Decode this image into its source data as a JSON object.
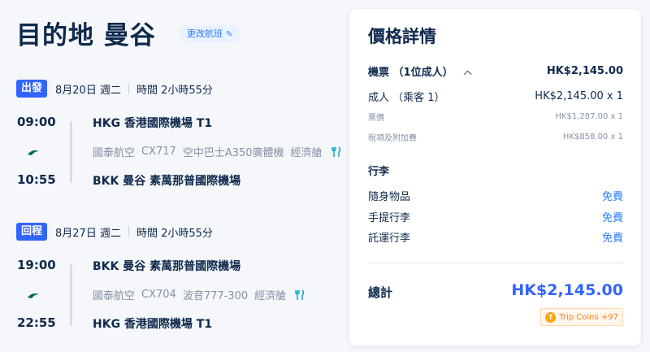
{
  "header": {
    "title": "目的地 曼谷",
    "change_label": "更改航班"
  },
  "outbound": {
    "badge": "出發",
    "date": "8月20日 週二",
    "duration": "時間 2小時55分",
    "depart_time": "09:00",
    "arrive_time": "10:55",
    "depart_place": "HKG 香港國際機場 T1",
    "arrive_place": "BKK 曼谷 素萬那普國際機場",
    "airline": "國泰航空",
    "flight_no": "CX717",
    "aircraft": "空中巴士A350廣體機",
    "cabin": "經濟艙"
  },
  "return": {
    "badge": "回程",
    "date": "8月27日 週二",
    "duration": "時間 2小時55分",
    "depart_time": "19:00",
    "arrive_time": "22:55",
    "depart_place": "BKK 曼谷 素萬那普國際機場",
    "arrive_place": "HKG 香港國際機場 T1",
    "airline": "國泰航空",
    "flight_no": "CX704",
    "aircraft": "波音777-300",
    "cabin": "經濟艙"
  },
  "price": {
    "title": "價格詳情",
    "ticket_label": "機票 （1位成人）",
    "ticket_total": "HK$2,145.00",
    "adult_label": "成人 （乘客 1）",
    "adult_value": "HK$2,145.00 x 1",
    "fare_label": "票價",
    "fare_value": "HK$1,287.00 x 1",
    "tax_label": "稅項及附加費",
    "tax_value": "HK$858.00 x 1",
    "baggage_title": "行李",
    "baggage": [
      {
        "label": "隨身物品",
        "value": "免費"
      },
      {
        "label": "手提行李",
        "value": "免費"
      },
      {
        "label": "託運行李",
        "value": "免費"
      }
    ],
    "total_label": "總計",
    "total_value": "HK$2,145.00",
    "coins_label": "Trip Coins +97"
  },
  "colors": {
    "accent": "#3264ff",
    "link": "#287dfa",
    "airline_teal": "#006564",
    "coins": "#ff7d13"
  }
}
